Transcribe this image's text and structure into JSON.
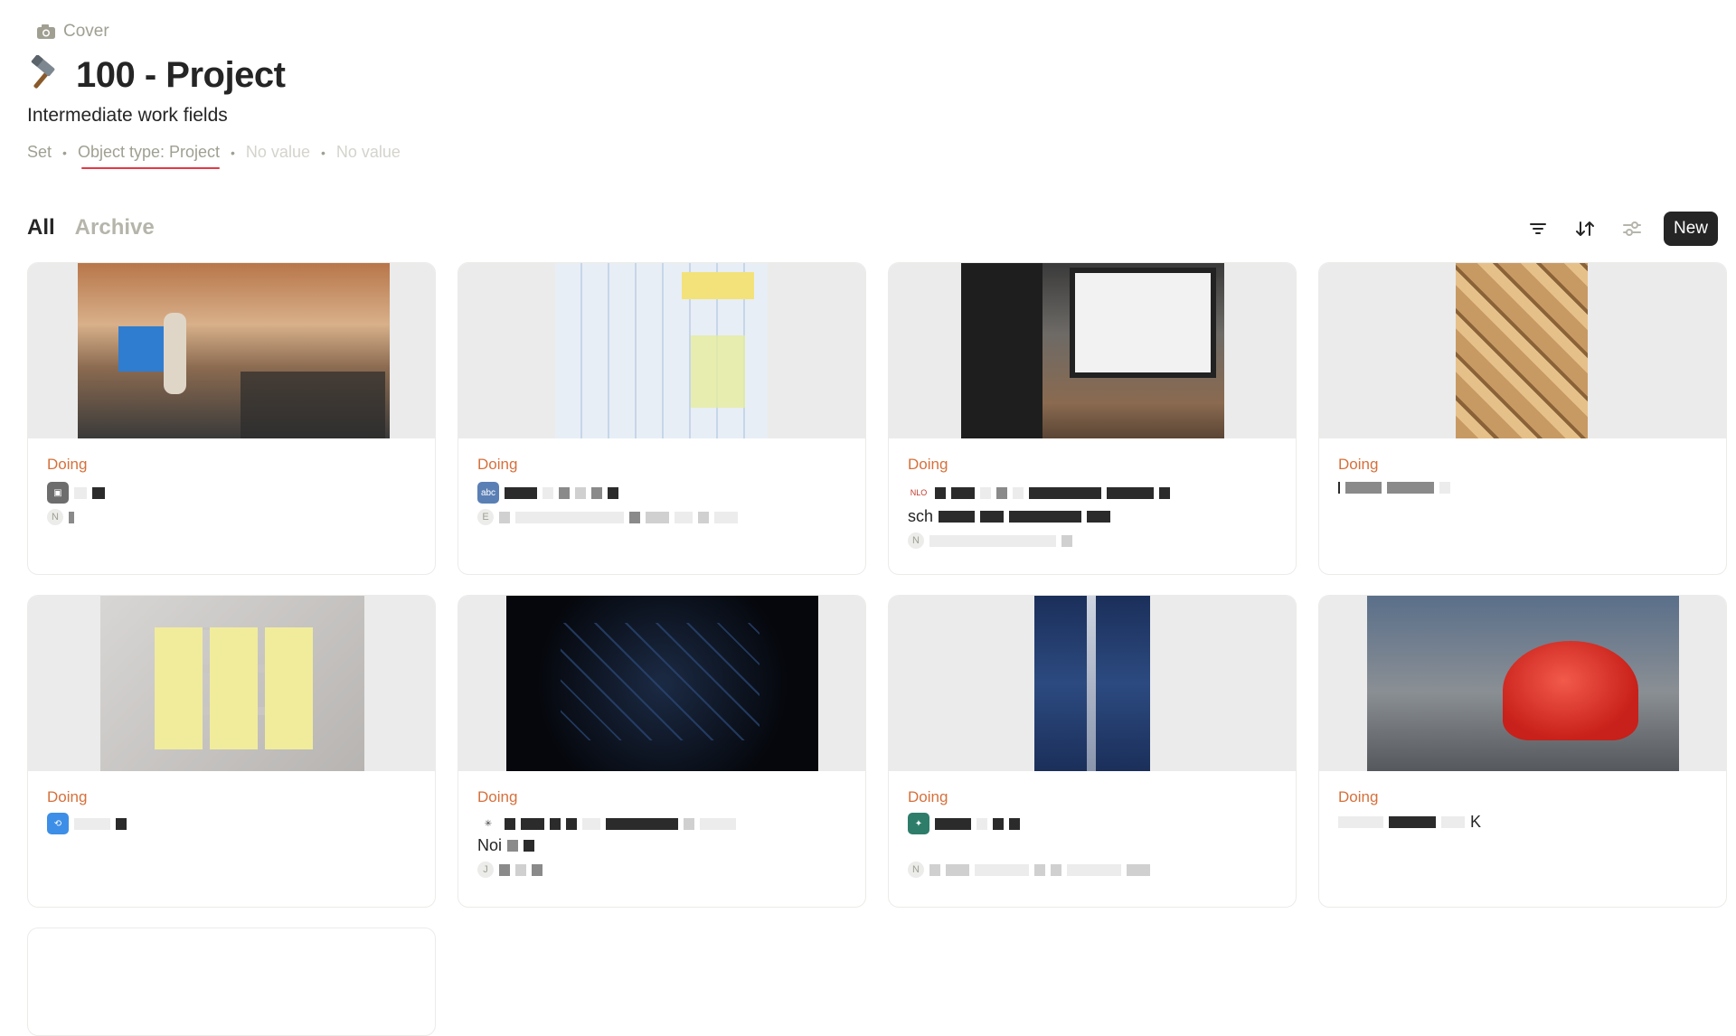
{
  "header": {
    "cover_label": "Cover",
    "title": "100 - Project",
    "subtitle": "Intermediate work fields"
  },
  "meta": {
    "set_label": "Set",
    "object_type": "Object type: Project",
    "value1": "No value",
    "value2": "No value"
  },
  "tabs": {
    "all": "All",
    "archive": "Archive"
  },
  "toolbar": {
    "filter_icon": "filter-icon",
    "sort_icon": "sort-icon",
    "settings_icon": "sliders-icon",
    "new_label": "New"
  },
  "accent": {
    "status_color": "#d6703b",
    "underline_color": "#e23a46"
  },
  "cards": [
    {
      "status": "Doing",
      "icon": "projector-icon",
      "avatar": "N"
    },
    {
      "status": "Doing",
      "icon": "abc-icon",
      "avatar": "E"
    },
    {
      "status": "Doing",
      "icon": "nlo-icon",
      "text": "sch",
      "avatar": "N"
    },
    {
      "status": "Doing"
    },
    {
      "status": "Doing",
      "icon": "repeat-icon"
    },
    {
      "status": "Doing",
      "icon": "spider-icon",
      "text": "Noi",
      "avatar": "J"
    },
    {
      "status": "Doing",
      "icon": "idea-icon",
      "avatar": "N"
    },
    {
      "status": "Doing",
      "text": "K"
    }
  ]
}
